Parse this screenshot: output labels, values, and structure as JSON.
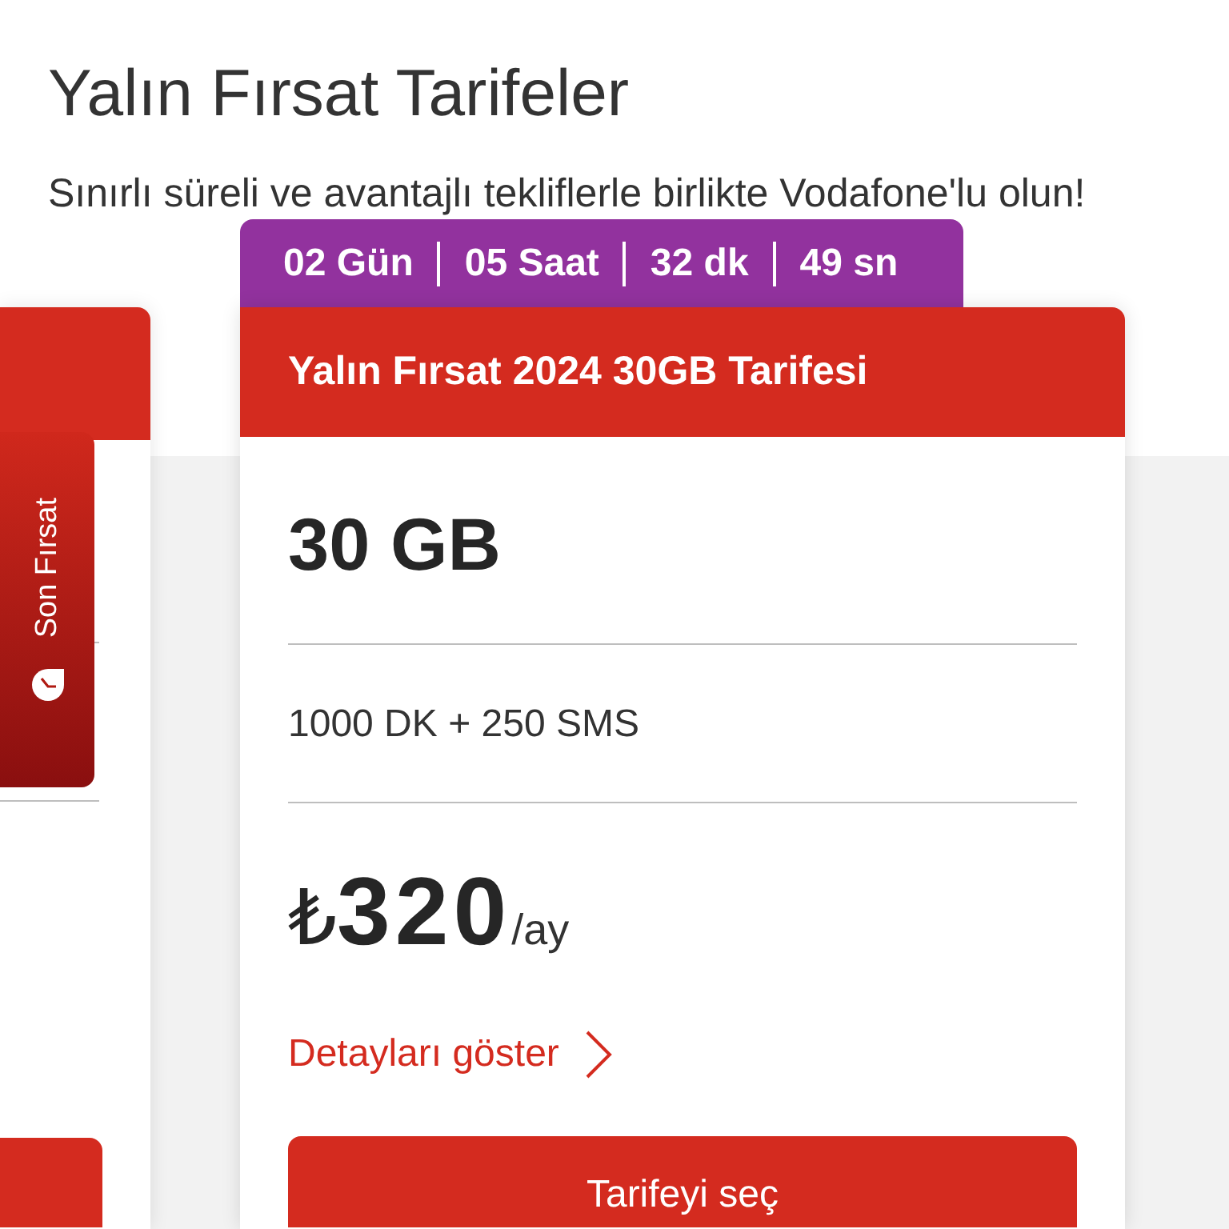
{
  "page": {
    "title": "Yalın Fırsat Tarifeler",
    "subtitle": "Sınırlı süreli ve avantajlı tekliflerle birlikte Vodafone'lu olun!"
  },
  "side_tab": {
    "label": "Son Fırsat"
  },
  "plan": {
    "countdown": [
      "02 Gün",
      "05 Saat",
      "32 dk",
      "49 sn"
    ],
    "title": "Yalın Fırsat 2024 30GB Tarifesi",
    "data": "30 GB",
    "allowance": "1000 DK + 250 SMS",
    "price": {
      "currency": "₺",
      "amount": "320",
      "period": "/ay"
    },
    "details_link": "Detayları göster",
    "select_button": "Tarifeyi seç"
  }
}
